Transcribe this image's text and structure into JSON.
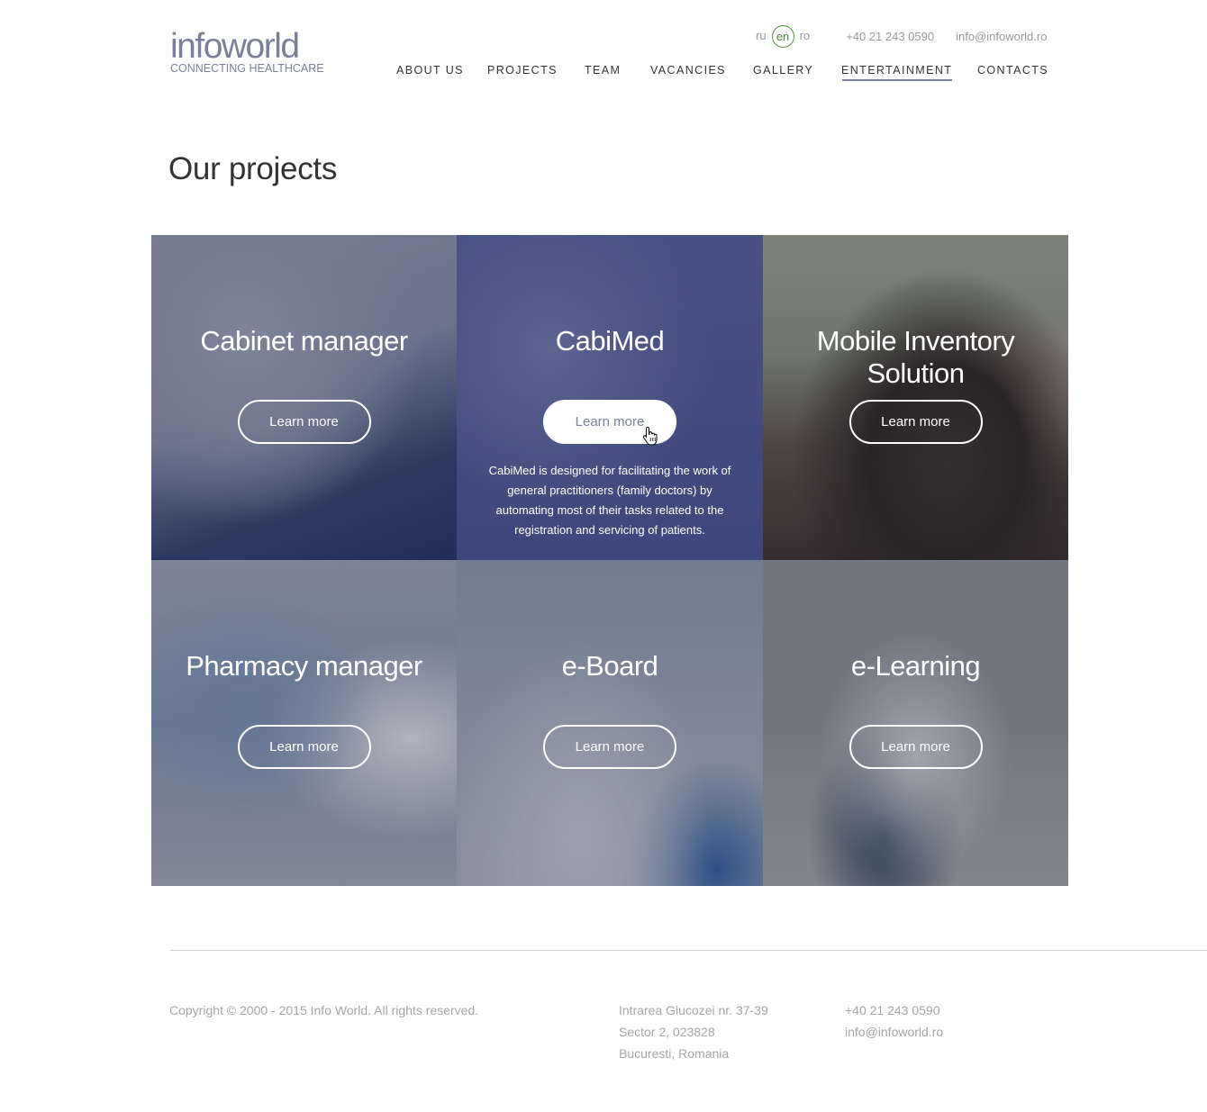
{
  "header": {
    "logo": {
      "wordmark": "infoworld",
      "tagline": "CONNECTING HEALTHCARE",
      "color": "#7b7f99"
    },
    "languages": [
      {
        "code": "ru",
        "active": false
      },
      {
        "code": "en",
        "active": true
      },
      {
        "code": "ro",
        "active": false
      }
    ],
    "phone": "+40 21 243 0590",
    "email": "info@infoworld.ro",
    "nav": [
      {
        "label": "ABOUT US",
        "active": false
      },
      {
        "label": "PROJECTS",
        "active": false
      },
      {
        "label": "TEAM",
        "active": false
      },
      {
        "label": "VACANCIES",
        "active": false
      },
      {
        "label": "GALLERY",
        "active": false
      },
      {
        "label": "ENTERTAINMENT",
        "active": true
      },
      {
        "label": "CONTACTS",
        "active": false
      }
    ],
    "accent_color": "#7b8099",
    "language_ring_color": "#4a9a3a"
  },
  "main": {
    "title": "Our projects",
    "projects": [
      {
        "title": "Cabinet manager",
        "button": "Learn more",
        "image": "stationery-brochure-cd-photo"
      },
      {
        "title": "CabiMed",
        "button": "Learn more",
        "image": "doctor-with-stethoscope-photo",
        "hovered": true,
        "description": "CabiMed is designed for facilitating the work of general practitioners (family doctors) by automating most of their tasks related to the registration and servicing of patients."
      },
      {
        "title": "Mobile Inventory Solution",
        "button": "Learn more",
        "image": "smartphone-vital-signs-photo"
      },
      {
        "title": "Pharmacy manager",
        "button": "Learn more",
        "image": "business-meeting-photo"
      },
      {
        "title": "e-Board",
        "button": "Learn more",
        "image": "doctor-typing-keyboard-photo"
      },
      {
        "title": "e-Learning",
        "button": "Learn more",
        "image": "doctor-with-laptop-photo"
      }
    ]
  },
  "footer": {
    "copyright": "Copyright © 2000 - 2015 Info World. All rights reserved.",
    "address": [
      "Intrarea Glucozei nr. 37-39",
      "Sector 2, 023828",
      "Bucuresti, Romania"
    ],
    "phone": "+40 21 243 0590",
    "email": "info@infoworld.ro"
  }
}
